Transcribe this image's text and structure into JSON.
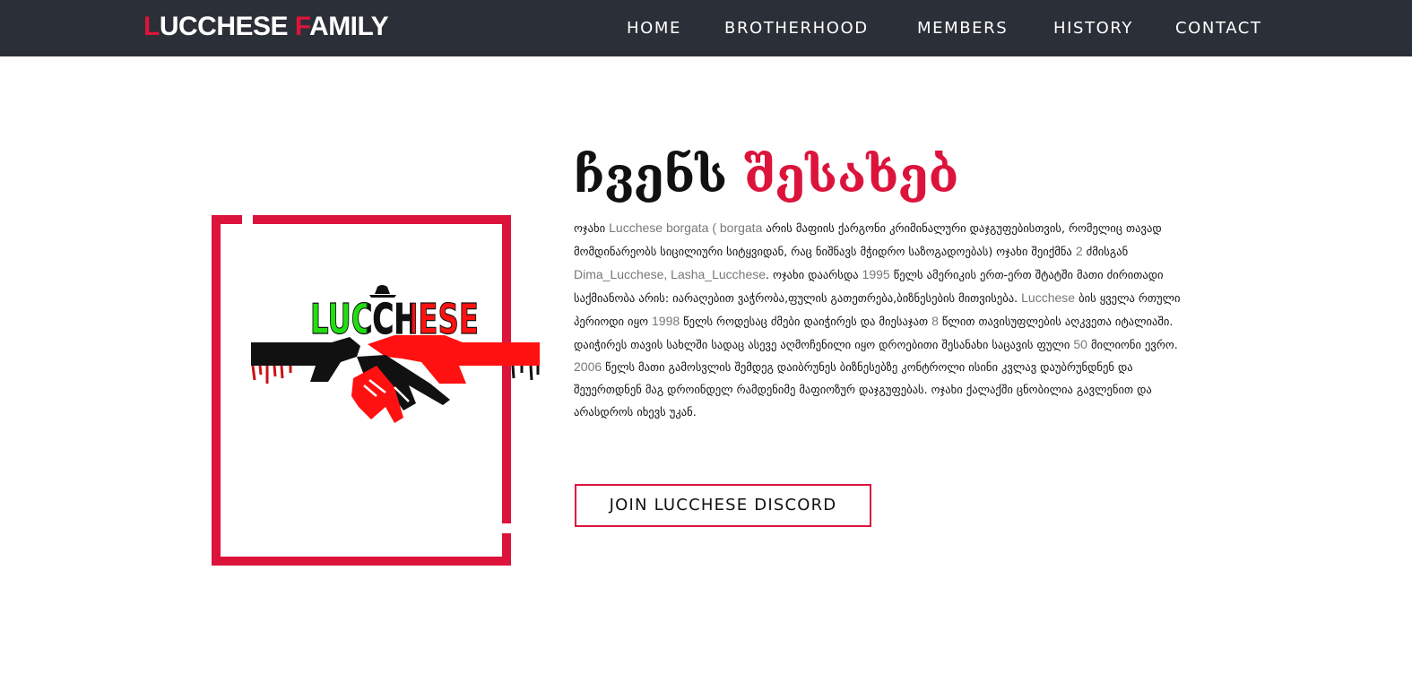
{
  "brand": {
    "first_initial": "L",
    "first_rest": "UCCHESE ",
    "second_initial": "F",
    "second_rest": "AMILY"
  },
  "nav": {
    "items": [
      {
        "label": "HOME"
      },
      {
        "label": "BROTHERHOOD"
      },
      {
        "label": "MEMBERS"
      },
      {
        "label": "HISTORY"
      },
      {
        "label": "CONTACT"
      }
    ]
  },
  "about": {
    "heading_dark": "ჩვენს",
    "heading_accent": "შესახებ",
    "paragraph": [
      {
        "text": "ოჯახი ",
        "highlight": false
      },
      {
        "text": "Lucchese borgata ( borgata",
        "highlight": true
      },
      {
        "text": " არის მაფიის ქარგონი კრიმინალური დაჯგუფებისთვის, რომელიც თავად მომდინარეობს სიცილიური სიტყვიდან, რაც ნიშნავს მჭიდრო საზოგადოებას) ოჯახი შეიქმნა ",
        "highlight": false
      },
      {
        "text": "2",
        "highlight": true
      },
      {
        "text": " ძმისგან ",
        "highlight": false
      },
      {
        "text": "Dima_Lucchese, Lasha_Lucchese",
        "highlight": true
      },
      {
        "text": ". ოჯახი დაარსდა ",
        "highlight": false
      },
      {
        "text": "1995",
        "highlight": true
      },
      {
        "text": " წელს ამერიკის ერთ-ერთ შტატში მათი ძირითადი საქმიანობა არის: იარაღებით ვაჭრობა,ფულის გათეთრება,ბიზნესების მითვისება. ",
        "highlight": false
      },
      {
        "text": "Lucchese",
        "highlight": true
      },
      {
        "text": " ბის ყველა რთული პერიოდი იყო ",
        "highlight": false
      },
      {
        "text": "1998",
        "highlight": true
      },
      {
        "text": " წელს როდესაც ძმები დაიჭირეს და მიესაჯათ ",
        "highlight": false
      },
      {
        "text": "8",
        "highlight": true
      },
      {
        "text": " წლით თავისუფლების აღკვეთა იტალიაში. დაიჭირეს თავის სახლში სადაც ასევე აღმოჩენილი იყო დროებითი შესანახი საცავის ფული ",
        "highlight": false
      },
      {
        "text": "50",
        "highlight": true
      },
      {
        "text": " მილიონი ევრო. ",
        "highlight": false
      },
      {
        "text": "2006",
        "highlight": true
      },
      {
        "text": " წელს მათი გამოსვლის შემდეგ დაიბრუნეს ბიზნესებზე კონტროლი ისინი კვლავ დაუბრუნდნენ და შეუერთდნენ მაგ დროინდელ რამდენიმე მაფიოზურ დაჯგუფებას. ოჯახი ქალაქში ცნობილია გავლენით და არასდროს იხევს უკან.",
        "highlight": false
      }
    ],
    "join_button": "JOIN LUCCHESE DISCORD"
  },
  "logo": {
    "wordmark": "LUCCHESE"
  },
  "colors": {
    "navbar_bg": "#2b3038",
    "accent": "#dc143c",
    "logo_green": "#22dd11",
    "logo_red": "#ff1111"
  }
}
